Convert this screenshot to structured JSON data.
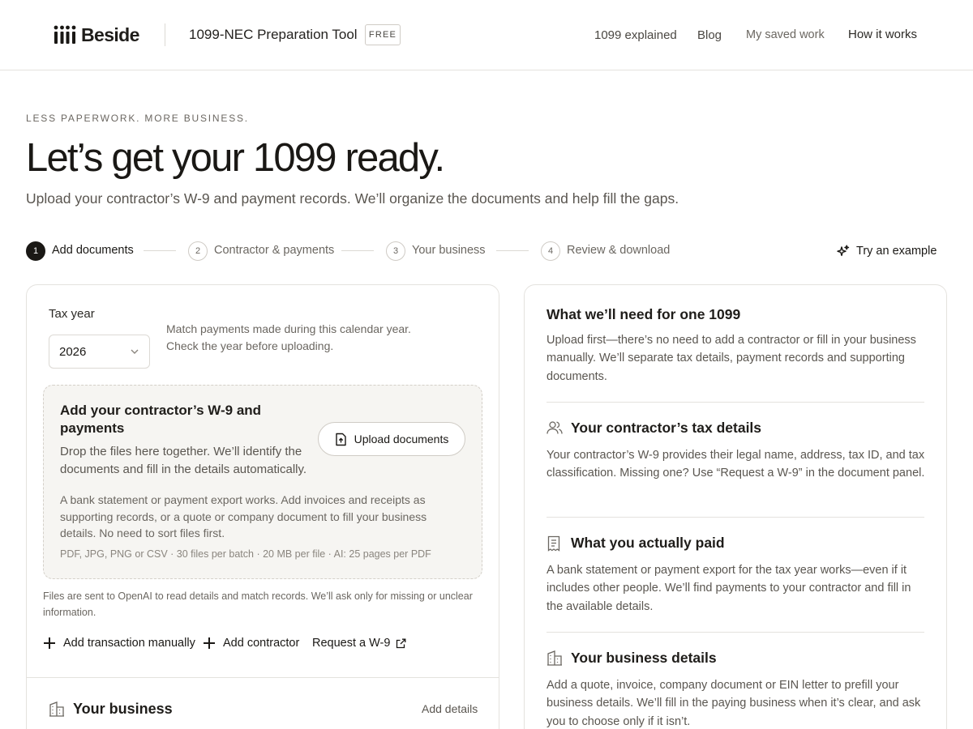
{
  "header": {
    "logo_text": "Beside",
    "tool_title": "1099-NEC Preparation Tool",
    "badge": "FREE",
    "nav": [
      "1099 explained",
      "Blog",
      "My saved work",
      "How it works"
    ]
  },
  "hero": {
    "eyebrow": "LESS PAPERWORK. MORE BUSINESS.",
    "title": "Let’s get your 1099 ready.",
    "subtitle": "Upload your contractor’s W-9 and payment records. We’ll organize the documents and help fill the gaps."
  },
  "stepper": {
    "steps": [
      {
        "num": "1",
        "label": "Add documents",
        "active": true
      },
      {
        "num": "2",
        "label": "Contractor & payments",
        "active": false
      },
      {
        "num": "3",
        "label": "Your business",
        "active": false
      },
      {
        "num": "4",
        "label": "Review & download",
        "active": false
      }
    ],
    "try_example": "Try an example"
  },
  "upload_card": {
    "tax_year_label": "Tax year",
    "tax_year_value": "2026",
    "tax_year_help": "Match payments made during this calendar year. Check the year before uploading.",
    "dropzone": {
      "title": "Add your contractor’s W-9 and payments",
      "description": "Drop the files here together. We’ll identify the documents and fill in the details automatically.",
      "upload_button": "Upload documents",
      "note": "A bank statement or payment export works. Add invoices and receipts as supporting records, or a quote or company document to fill your business details. No need to sort files first.",
      "formats": "PDF, JPG, PNG or CSV · 30 files per batch · 20 MB per file · AI: 25 pages per PDF"
    },
    "privacy_note": "Files are sent to OpenAI to read details and match records. We’ll ask only for missing or unclear information.",
    "actions": {
      "add_transaction": "Add transaction manually",
      "add_contractor": "Add contractor",
      "request_w9": "Request a W-9"
    },
    "business_section": {
      "title": "Your business",
      "add_details": "Add details"
    }
  },
  "info_card": {
    "title": "What we’ll need for one 1099",
    "intro": "Upload first—there’s no need to add a contractor or fill in your business manually. We’ll separate tax details, payment records and supporting documents.",
    "sections": [
      {
        "icon": "users-icon",
        "title": "Your contractor’s tax details",
        "text": "Your contractor’s W-9 provides their legal name, address, tax ID, and tax classification. Missing one? Use “Request a W-9” in the document panel."
      },
      {
        "icon": "receipt-icon",
        "title": "What you actually paid",
        "text": "A bank statement or payment export for the tax year works—even if it includes other people. We’ll find payments to your contractor and fill in the available details."
      },
      {
        "icon": "building-icon",
        "title": "Your business details",
        "text": "Add a quote, invoice, company document or EIN letter to prefill your business details. We’ll fill in the paying business when it’s clear, and ask you to choose only if it isn’t."
      }
    ]
  },
  "colors": {
    "text": "#1a1815",
    "muted": "#6b6761",
    "border": "#e4e2de",
    "dropzone_bg": "#f6f5f2"
  }
}
